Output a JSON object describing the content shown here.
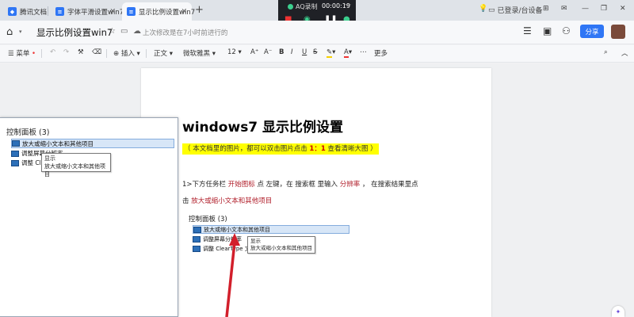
{
  "tabs": [
    {
      "label": "腾讯文档",
      "icon": "tencent-docs-icon",
      "color": "#2f76f5"
    },
    {
      "label": "字体平滑设置win7",
      "icon": "doc-icon",
      "color": "#2f76f5"
    },
    {
      "label": "显示比例设置win7",
      "icon": "doc-icon",
      "color": "#2f76f5",
      "active": true
    }
  ],
  "recorder": {
    "title": "AQ录制",
    "time": "00:00:19"
  },
  "tray": {
    "login": "已登录/台设备"
  },
  "doc": {
    "title": "显示比例设置win7",
    "saved": "上次修改是在7小时前进行的",
    "share": "分享"
  },
  "toolbar": {
    "menu": "菜单",
    "insert": "插入",
    "style": "正文",
    "font": "微软雅黑",
    "size": "12",
    "more": "更多"
  },
  "content": {
    "heading": "windows7  显示比例设置",
    "note_pre": "（ 本文档里的图片，都可以双击图片点击 ",
    "note_bold": "1：1",
    "note_post": " 查看清晰大图 ）",
    "p1_a": "1>下方任务栏  ",
    "p1_b": "开始图标",
    "p1_c": "   点  左键，在  搜索框  里输入  ",
    "p1_d": "分辨率",
    "p1_e": " ，  在搜索结果里点",
    "p2_a": "击  ",
    "p2_b": "放大或缩小文本和其他项目"
  },
  "panel": {
    "title": "控制面板 (3)",
    "row1": "放大或缩小文本和其他项目",
    "row2": "调整屏幕分辨率",
    "row3": "调整 ClearType 文本",
    "tip1": "显示",
    "tip2": "放大或缩小文本和其他项目"
  },
  "embedded": {
    "title": "控制面板 (3)",
    "row1": "放大或缩小文本和其他项目",
    "row2": "调整屏幕分辨率",
    "row3": "调整  ClearType 文本",
    "tip1": "显示",
    "tip2": "放大或缩小文本和其他项目"
  }
}
